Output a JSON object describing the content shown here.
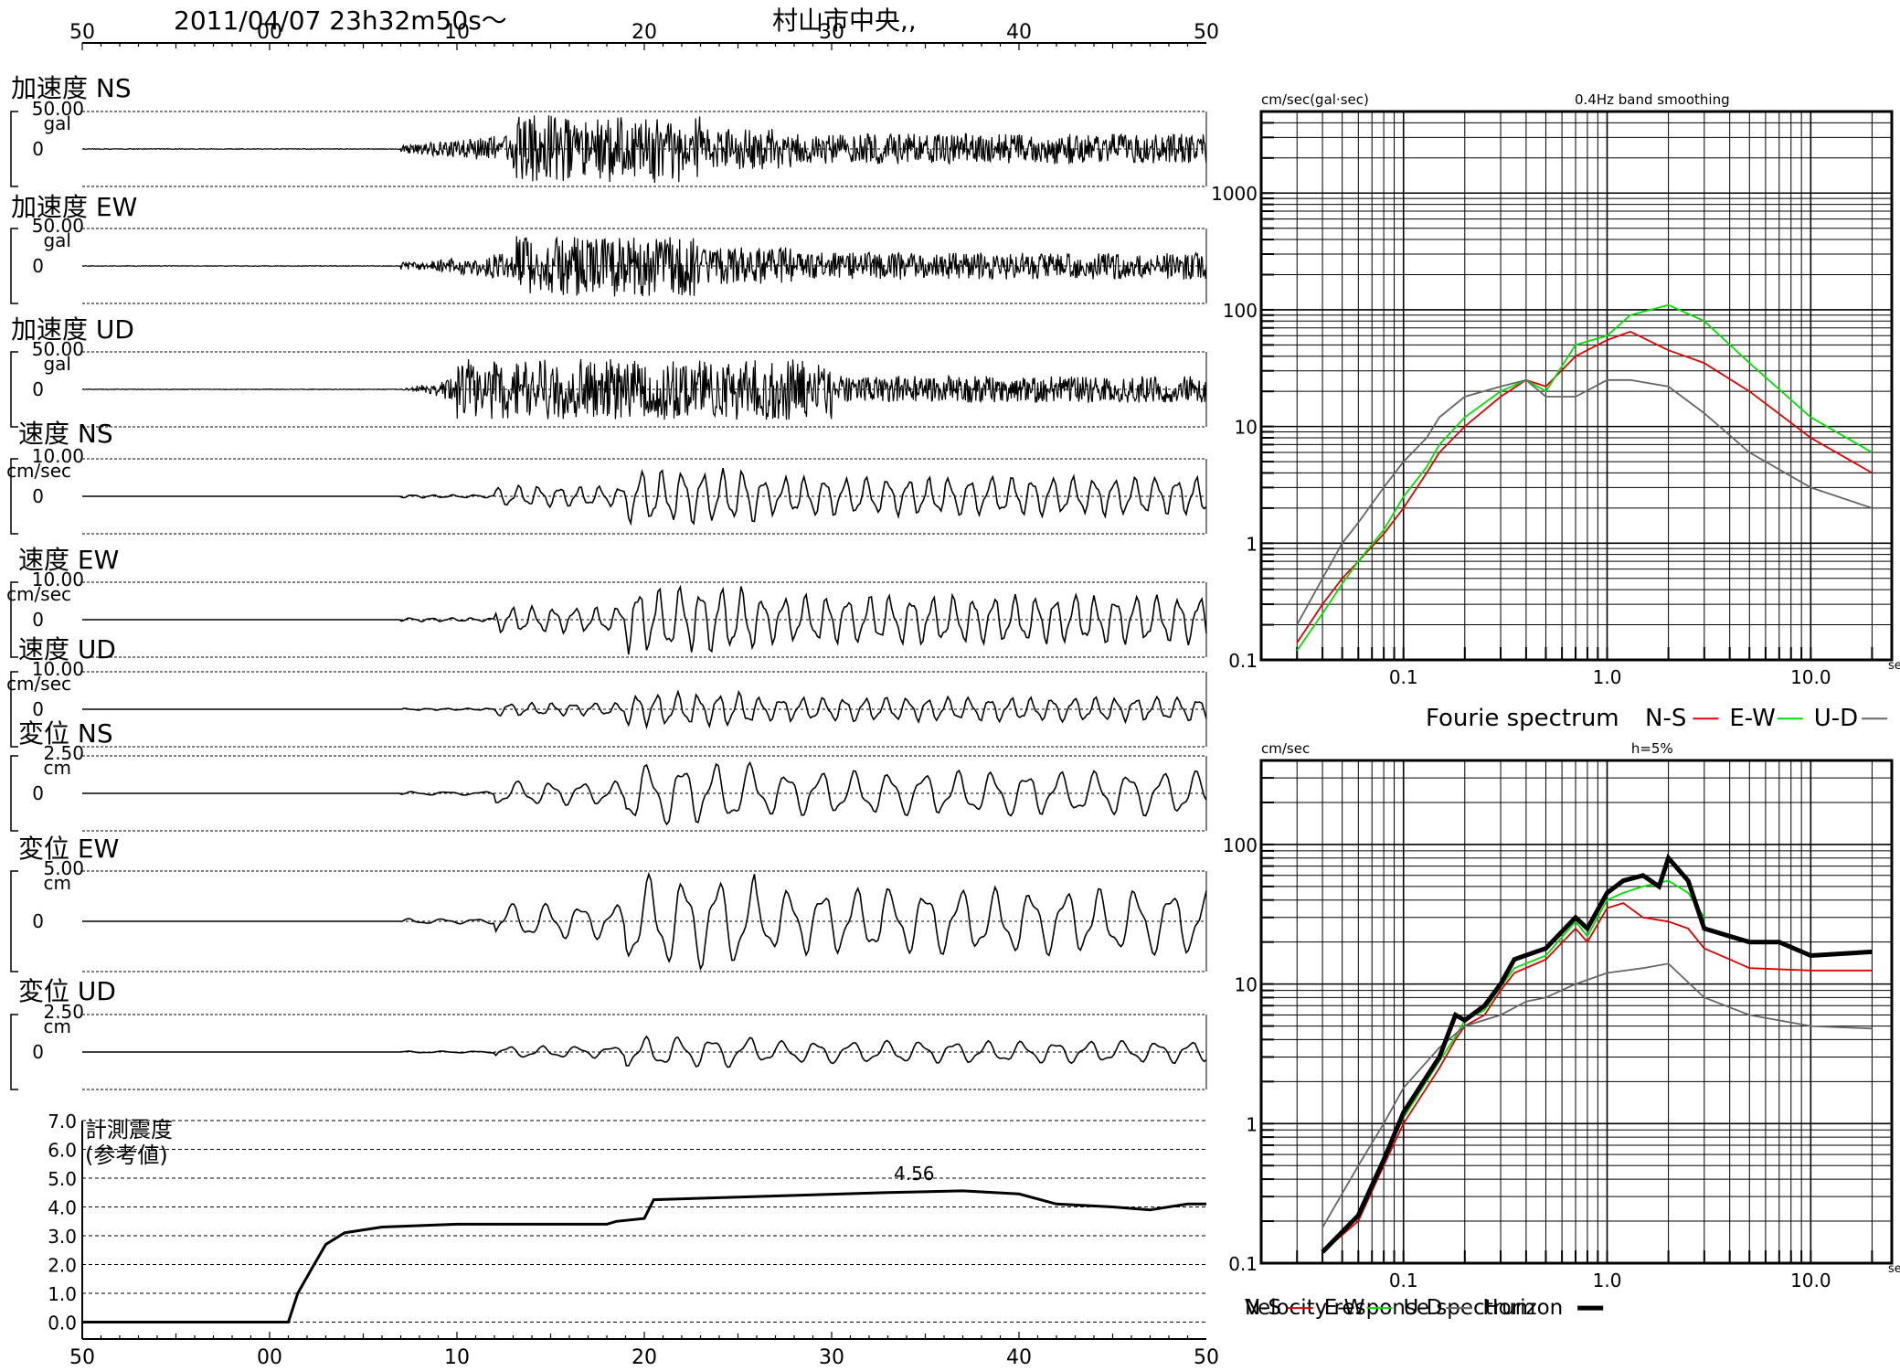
{
  "header": {
    "datetime": "2011/04/07  23h32m50s〜",
    "station": "村山市中央,,"
  },
  "time_axis": {
    "ticks": [
      "50",
      "00",
      "10",
      "20",
      "30",
      "40",
      "50"
    ]
  },
  "waveforms": {
    "title": "",
    "unit_gal": "gal",
    "unit_vel": "cm/sec",
    "unit_disp": "cm",
    "zero_label": "0",
    "channels": [
      {
        "label": "加速度 NS",
        "scale": "50.00",
        "unit": "gal",
        "kind": "acc",
        "amp": 1.0,
        "seed": 1
      },
      {
        "label": "加速度 EW",
        "scale": "50.00",
        "unit": "gal",
        "kind": "acc",
        "amp": 0.9,
        "seed": 2
      },
      {
        "label": "加速度 UD",
        "scale": "50.00",
        "unit": "gal",
        "kind": "accud",
        "amp": 0.9,
        "seed": 3
      },
      {
        "label": "速度 NS",
        "scale": "10.00",
        "unit": "cm/sec",
        "kind": "vel",
        "amp": 0.8,
        "seed": 4
      },
      {
        "label": "速度 EW",
        "scale": "10.00",
        "unit": "cm/sec",
        "kind": "vel",
        "amp": 1.0,
        "seed": 5
      },
      {
        "label": "速度 UD",
        "scale": "10.00",
        "unit": "cm/sec",
        "kind": "velud",
        "amp": 0.5,
        "seed": 6
      },
      {
        "label": "変位 NS",
        "scale": "2.50",
        "unit": "cm",
        "kind": "disp",
        "amp": 0.9,
        "seed": 7
      },
      {
        "label": "変位 EW",
        "scale": "5.00",
        "unit": "cm",
        "kind": "disp",
        "amp": 1.0,
        "seed": 8
      },
      {
        "label": "変位 UD",
        "scale": "2.50",
        "unit": "cm",
        "kind": "dispud",
        "amp": 0.45,
        "seed": 9
      }
    ]
  },
  "intensity": {
    "label_line1": "計測震度",
    "label_line2": "(参考値)",
    "yticks": [
      "7.0",
      "6.0",
      "5.0",
      "4.0",
      "3.0",
      "2.0",
      "1.0",
      "0.0"
    ],
    "peak_label": "4.56"
  },
  "chart_data": [
    {
      "type": "line",
      "title": "Fourie spectrum",
      "ylabel": "cm/sec(gal·sec)",
      "note": "0.4Hz band smoothing",
      "xunit": "sec",
      "xscale": "log",
      "yscale": "log",
      "xlim": [
        0.02,
        25
      ],
      "ylim": [
        0.1,
        5000
      ],
      "xtick_labels": [
        "0.1",
        "1.0",
        "10.0"
      ],
      "ytick_labels": [
        "0.1",
        "1",
        "10",
        "100",
        "1000"
      ],
      "series": [
        {
          "name": "N-S",
          "color": "#e00000",
          "x": [
            0.03,
            0.04,
            0.05,
            0.06,
            0.08,
            0.1,
            0.13,
            0.15,
            0.2,
            0.3,
            0.4,
            0.5,
            0.7,
            1.0,
            1.3,
            2.0,
            3.0,
            5.0,
            10.0,
            20.0
          ],
          "y": [
            0.14,
            0.3,
            0.5,
            0.7,
            1.2,
            2.0,
            4.0,
            6.0,
            10.0,
            18.0,
            25.0,
            22.0,
            40.0,
            55.0,
            65.0,
            45.0,
            35.0,
            20.0,
            8.0,
            4.0
          ]
        },
        {
          "name": "E-W",
          "color": "#00e000",
          "x": [
            0.03,
            0.04,
            0.05,
            0.06,
            0.08,
            0.1,
            0.13,
            0.15,
            0.2,
            0.3,
            0.4,
            0.5,
            0.7,
            1.0,
            1.3,
            2.0,
            3.0,
            5.0,
            10.0,
            20.0
          ],
          "y": [
            0.12,
            0.25,
            0.45,
            0.7,
            1.3,
            2.5,
            4.5,
            7.0,
            12.0,
            20.0,
            25.0,
            20.0,
            50.0,
            60.0,
            90.0,
            110.0,
            80.0,
            35.0,
            12.0,
            6.0
          ]
        },
        {
          "name": "U-D",
          "color": "#666666",
          "x": [
            0.03,
            0.04,
            0.05,
            0.06,
            0.08,
            0.1,
            0.13,
            0.15,
            0.2,
            0.3,
            0.4,
            0.5,
            0.7,
            1.0,
            1.3,
            2.0,
            3.0,
            5.0,
            10.0,
            20.0
          ],
          "y": [
            0.2,
            0.5,
            1.0,
            1.5,
            3.0,
            5.0,
            8.0,
            12.0,
            18.0,
            22.0,
            25.0,
            18.0,
            18.0,
            25.0,
            25.0,
            22.0,
            13.0,
            6.0,
            3.0,
            2.0
          ]
        }
      ]
    },
    {
      "type": "line",
      "title": "Velocity response spectrum",
      "ylabel": "cm/sec",
      "note": "h=5%",
      "xunit": "sec",
      "xscale": "log",
      "yscale": "log",
      "xlim": [
        0.02,
        25
      ],
      "ylim": [
        0.1,
        400
      ],
      "xtick_labels": [
        "0.1",
        "1.0",
        "10.0"
      ],
      "ytick_labels": [
        "0.1",
        "1",
        "10",
        "100"
      ],
      "series": [
        {
          "name": "N-S",
          "color": "#e00000",
          "x": [
            0.04,
            0.06,
            0.08,
            0.1,
            0.15,
            0.18,
            0.2,
            0.25,
            0.3,
            0.35,
            0.5,
            0.7,
            0.8,
            1.0,
            1.2,
            1.5,
            2.0,
            2.5,
            3.0,
            4.0,
            5.0,
            10.0,
            20.0
          ],
          "y": [
            0.12,
            0.2,
            0.5,
            1.0,
            2.5,
            4.0,
            5.0,
            6.0,
            9.0,
            12.0,
            15.0,
            25.0,
            20.0,
            35.0,
            38.0,
            30.0,
            28.0,
            25.0,
            18.0,
            15.0,
            13.0,
            12.5,
            12.5
          ]
        },
        {
          "name": "E-W",
          "color": "#00e000",
          "x": [
            0.04,
            0.06,
            0.08,
            0.1,
            0.15,
            0.18,
            0.2,
            0.25,
            0.3,
            0.35,
            0.5,
            0.7,
            0.8,
            1.0,
            1.2,
            1.5,
            2.0,
            2.5,
            3.0
          ],
          "y": [
            0.12,
            0.22,
            0.55,
            1.1,
            2.8,
            4.2,
            5.5,
            6.5,
            9.5,
            13.0,
            16.0,
            28.0,
            22.0,
            40.0,
            45.0,
            50.0,
            55.0,
            45.0,
            30.0
          ]
        },
        {
          "name": "U-D",
          "color": "#666666",
          "x": [
            0.04,
            0.06,
            0.08,
            0.1,
            0.15,
            0.2,
            0.3,
            0.4,
            0.5,
            0.7,
            1.0,
            1.5,
            2.0,
            3.0,
            5.0,
            10.0,
            20.0
          ],
          "y": [
            0.18,
            0.5,
            1.0,
            1.8,
            3.5,
            5.0,
            6.0,
            7.5,
            8.0,
            10.0,
            12.0,
            13.0,
            14.0,
            8.0,
            6.0,
            5.0,
            4.8
          ]
        },
        {
          "name": "Horizon",
          "color": "#000000",
          "x": [
            0.04,
            0.06,
            0.08,
            0.1,
            0.15,
            0.18,
            0.2,
            0.25,
            0.3,
            0.35,
            0.5,
            0.7,
            0.8,
            1.0,
            1.2,
            1.5,
            1.8,
            2.0,
            2.5,
            3.0,
            4.0,
            5.0,
            7.0,
            10.0,
            20.0
          ],
          "y": [
            0.12,
            0.22,
            0.55,
            1.2,
            3.0,
            6.0,
            5.5,
            7.0,
            10.0,
            15.0,
            18.0,
            30.0,
            25.0,
            45.0,
            55.0,
            60.0,
            50.0,
            80.0,
            55.0,
            25.0,
            22.0,
            20.0,
            20.0,
            16.0,
            17.0
          ]
        }
      ]
    }
  ]
}
